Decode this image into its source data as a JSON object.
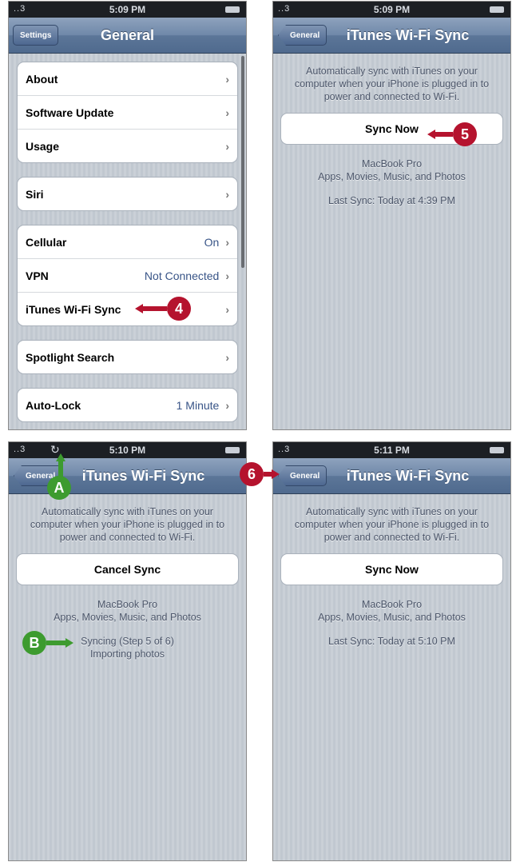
{
  "colors": {
    "callout_red": "#b5132e",
    "callout_green": "#3d9b2f",
    "nav_blue": "#5c7698",
    "value_blue": "#385487"
  },
  "panel1": {
    "status": {
      "signal": "..3",
      "time": "5:09 PM"
    },
    "nav": {
      "back": "Settings",
      "title": "General"
    },
    "groups": [
      [
        {
          "label": "About"
        },
        {
          "label": "Software Update"
        },
        {
          "label": "Usage"
        }
      ],
      [
        {
          "label": "Siri"
        }
      ],
      [
        {
          "label": "Cellular",
          "value": "On"
        },
        {
          "label": "VPN",
          "value": "Not Connected"
        },
        {
          "label": "iTunes Wi-Fi Sync"
        }
      ],
      [
        {
          "label": "Spotlight Search"
        }
      ],
      [
        {
          "label": "Auto-Lock",
          "value": "1 Minute"
        }
      ]
    ],
    "callout": "4"
  },
  "panel2": {
    "status": {
      "signal": "..3",
      "time": "5:09 PM"
    },
    "nav": {
      "back": "General",
      "title": "iTunes Wi-Fi Sync"
    },
    "description": "Automatically sync with iTunes on your computer when your iPhone is plugged in to power and connected to Wi-Fi.",
    "button": "Sync Now",
    "device": "MacBook Pro",
    "content": "Apps, Movies, Music, and Photos",
    "last_sync": "Last Sync: Today at 4:39 PM",
    "callout": "5"
  },
  "panel3": {
    "status": {
      "signal": "..3",
      "time": "5:10 PM"
    },
    "nav": {
      "back": "General",
      "title": "iTunes Wi-Fi Sync"
    },
    "description": "Automatically sync with iTunes on your computer when your iPhone is plugged in to power and connected to Wi-Fi.",
    "button": "Cancel Sync",
    "device": "MacBook Pro",
    "content": "Apps, Movies, Music, and Photos",
    "sync_status": "Syncing (Step 5 of 6)",
    "sync_detail": "Importing photos",
    "callout_a": "A",
    "callout_b": "B"
  },
  "panel4": {
    "status": {
      "signal": "..3",
      "time": "5:11 PM"
    },
    "nav": {
      "back": "General",
      "title": "iTunes Wi-Fi Sync"
    },
    "description": "Automatically sync with iTunes on your computer when your iPhone is plugged in to power and connected to Wi-Fi.",
    "button": "Sync Now",
    "device": "MacBook Pro",
    "content": "Apps, Movies, Music, and Photos",
    "last_sync": "Last Sync: Today at 5:10 PM",
    "callout": "6"
  }
}
